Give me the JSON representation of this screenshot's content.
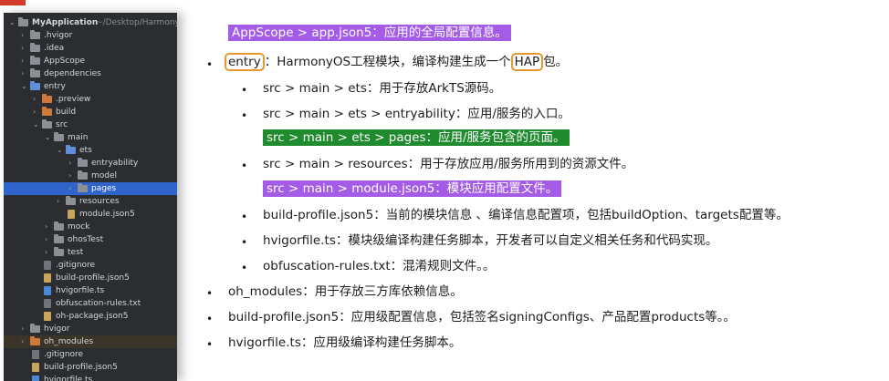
{
  "tree": {
    "rows": [
      {
        "label": "MyApplication",
        "path": "~/Desktop/Harmony/p",
        "depth": 0,
        "type": "project",
        "expanded": true
      },
      {
        "label": ".hvigor",
        "depth": 1,
        "type": "folder",
        "expanded": false
      },
      {
        "label": ".idea",
        "depth": 1,
        "type": "folder",
        "expanded": false
      },
      {
        "label": "AppScope",
        "depth": 1,
        "type": "folder",
        "expanded": false
      },
      {
        "label": "dependencies",
        "depth": 1,
        "type": "folder",
        "expanded": false
      },
      {
        "label": "entry",
        "depth": 1,
        "type": "folder-module",
        "expanded": true
      },
      {
        "label": ".preview",
        "depth": 2,
        "type": "folder-orange",
        "expanded": false
      },
      {
        "label": "build",
        "depth": 2,
        "type": "folder-orange",
        "expanded": false
      },
      {
        "label": "src",
        "depth": 2,
        "type": "folder",
        "expanded": true
      },
      {
        "label": "main",
        "depth": 3,
        "type": "folder",
        "expanded": true
      },
      {
        "label": "ets",
        "depth": 4,
        "type": "folder-blue",
        "expanded": true
      },
      {
        "label": "entryability",
        "depth": 5,
        "type": "folder",
        "expanded": false
      },
      {
        "label": "model",
        "depth": 5,
        "type": "folder",
        "expanded": false
      },
      {
        "label": "pages",
        "depth": 5,
        "type": "folder",
        "expanded": false,
        "selected": true
      },
      {
        "label": "resources",
        "depth": 4,
        "type": "folder",
        "expanded": false
      },
      {
        "label": "module.json5",
        "depth": 4,
        "type": "file-json"
      },
      {
        "label": "mock",
        "depth": 3,
        "type": "folder",
        "expanded": false
      },
      {
        "label": "ohosTest",
        "depth": 3,
        "type": "folder",
        "expanded": false
      },
      {
        "label": "test",
        "depth": 3,
        "type": "folder",
        "expanded": false
      },
      {
        "label": ".gitignore",
        "depth": 2,
        "type": "file"
      },
      {
        "label": "build-profile.json5",
        "depth": 2,
        "type": "file-json"
      },
      {
        "label": "hvigorfile.ts",
        "depth": 2,
        "type": "file-ts"
      },
      {
        "label": "obfuscation-rules.txt",
        "depth": 2,
        "type": "file"
      },
      {
        "label": "oh-package.json5",
        "depth": 2,
        "type": "file-json"
      },
      {
        "label": "hvigor",
        "depth": 1,
        "type": "folder",
        "expanded": false
      },
      {
        "label": "oh_modules",
        "depth": 1,
        "type": "folder-orange",
        "expanded": false,
        "highlight": true
      },
      {
        "label": ".gitignore",
        "depth": 1,
        "type": "file"
      },
      {
        "label": "build-profile.json5",
        "depth": 1,
        "type": "file-json"
      },
      {
        "label": "hvigorfile.ts",
        "depth": 1,
        "type": "file-ts"
      }
    ]
  },
  "notes": {
    "appscope": "AppScope > app.json5：应用的全局配置信息。",
    "entry_head": "entry",
    "entry_mid": "：HarmonyOS工程模块，编译构建生成一个",
    "entry_hap": "HAP",
    "entry_tail": "包。",
    "ets": "src > main > ets：用于存放ArkTS源码。",
    "entryability": "src > main > ets > entryability：应用/服务的入口。",
    "pages": "src > main > ets > pages：应用/服务包含的页面。",
    "resources": "src > main > resources：用于存放应用/服务所用到的资源文件。",
    "module_json": "src > main > module.json5：模块应用配置文件。",
    "build_profile_module": "build-profile.json5：当前的模块信息 、编译信息配置项，包括buildOption、targets配置等。",
    "hvigorfile_module": "hvigorfile.ts：模块级编译构建任务脚本，开发者可以自定义相关任务和代码实现。",
    "obfuscation": "obfuscation-rules.txt：混淆规则文件。。",
    "oh_modules": "oh_modules：用于存放三方库依赖信息。",
    "build_profile_app": "build-profile.json5：应用级配置信息，包括签名signingConfigs、产品配置products等。。",
    "hvigorfile_app": "hvigorfile.ts：应用级编译构建任务脚本。",
    "bullet_l1": "•",
    "bullet_l2": "•"
  },
  "colors": {
    "purple_highlight": "#a45ce6",
    "green_highlight": "#1f8a2e",
    "orange_box": "#e19a2d",
    "tree_bg": "#2b2d30",
    "tree_selected": "#2f65ca"
  }
}
